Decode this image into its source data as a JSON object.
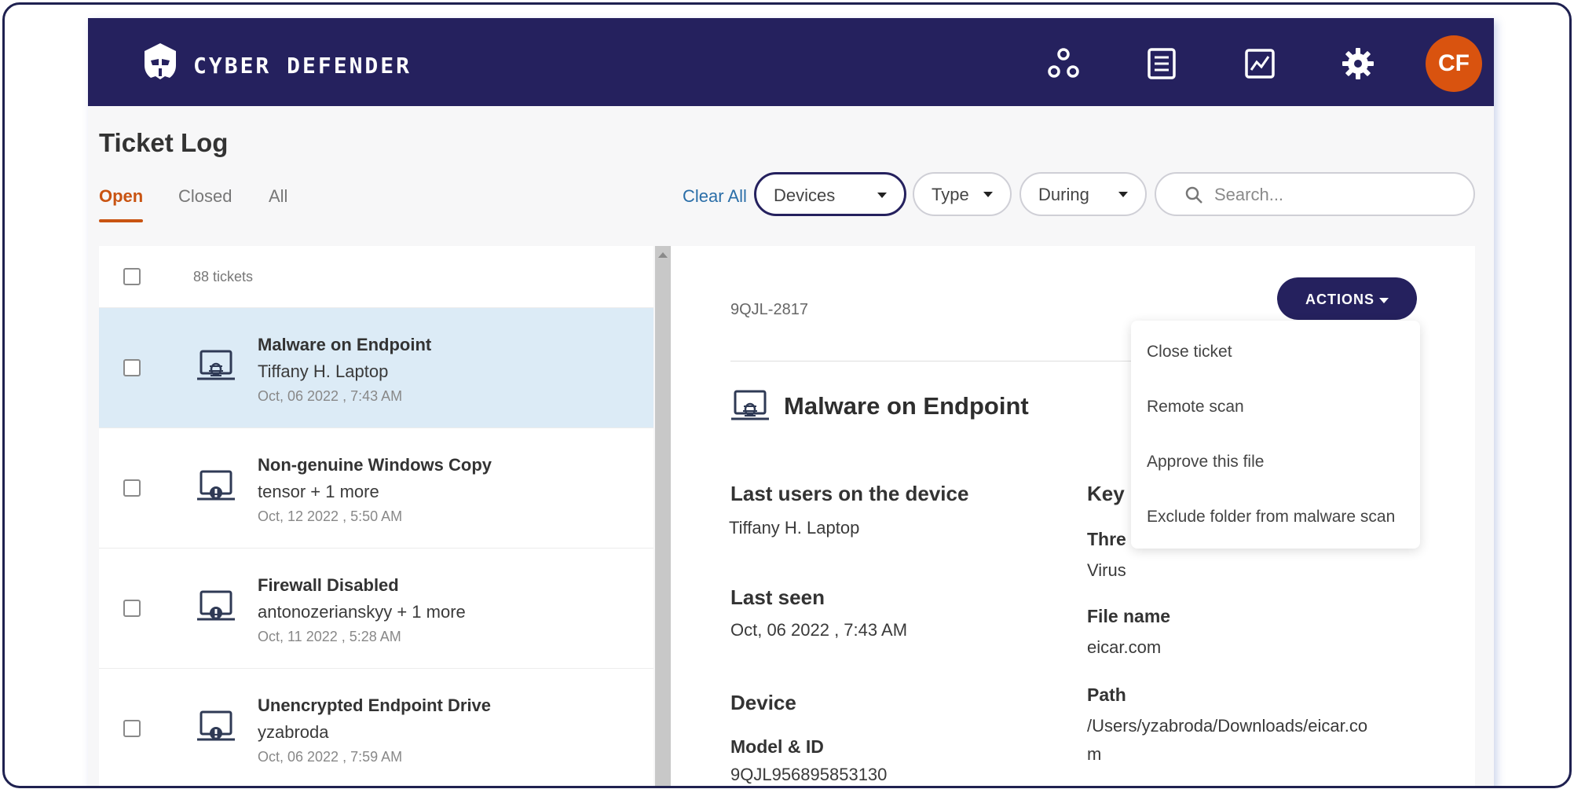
{
  "header": {
    "brand": "CYBER DEFENDER",
    "avatar_initials": "CF",
    "avatar_color": "#d9530f",
    "bar_color": "#25215e",
    "nav_icons": [
      "network-icon",
      "list-icon",
      "chart-icon",
      "gear-icon"
    ]
  },
  "page": {
    "title": "Ticket Log",
    "tabs": [
      {
        "label": "Open",
        "active": true
      },
      {
        "label": "Closed",
        "active": false
      },
      {
        "label": "All",
        "active": false
      }
    ]
  },
  "filters": {
    "clear_all": "Clear All",
    "devices": "Devices",
    "type": "Type",
    "during": "During",
    "search_placeholder": "Search..."
  },
  "list": {
    "count": "88 tickets",
    "tickets": [
      {
        "title": "Malware on Endpoint",
        "device": "Tiffany H. Laptop",
        "date": "Oct, 06 2022 , 7:43 AM",
        "icon": "malware-device-icon",
        "selected": true
      },
      {
        "title": "Non-genuine Windows Copy",
        "device": "tensor + 1 more",
        "date": "Oct, 12 2022 , 5:50 AM",
        "icon": "alert-device-icon",
        "selected": false
      },
      {
        "title": "Firewall Disabled",
        "device": "antonozerianskyy + 1 more",
        "date": "Oct, 11 2022 , 5:28 AM",
        "icon": "alert-device-icon",
        "selected": false
      },
      {
        "title": "Unencrypted Endpoint Drive",
        "device": "yzabroda",
        "date": "Oct, 06 2022 , 7:59 AM",
        "icon": "alert-device-icon",
        "selected": false
      }
    ]
  },
  "detail": {
    "ticket_id": "9QJL-2817",
    "actions_label": "ACTIONS",
    "title": "Malware on Endpoint",
    "last_users_heading": "Last users on the device",
    "last_users_value": "Tiffany H. Laptop",
    "last_seen_heading": "Last seen",
    "last_seen_value": "Oct, 06 2022 , 7:43 AM",
    "device_heading": "Device",
    "model_heading": "Model & ID",
    "model_value": "9QJL956895853130",
    "key_heading": "Key",
    "threat_heading": "Thre",
    "threat_value": "Virus",
    "file_name_heading": "File name",
    "file_name_value": "eicar.com",
    "path_heading": "Path",
    "path_line1": "/Users/yzabroda/Downloads/eicar.co",
    "path_line2": "m"
  },
  "actions_menu": {
    "items": [
      "Close ticket",
      "Remote scan",
      "Approve this file",
      "Exclude folder from malware scan"
    ]
  }
}
